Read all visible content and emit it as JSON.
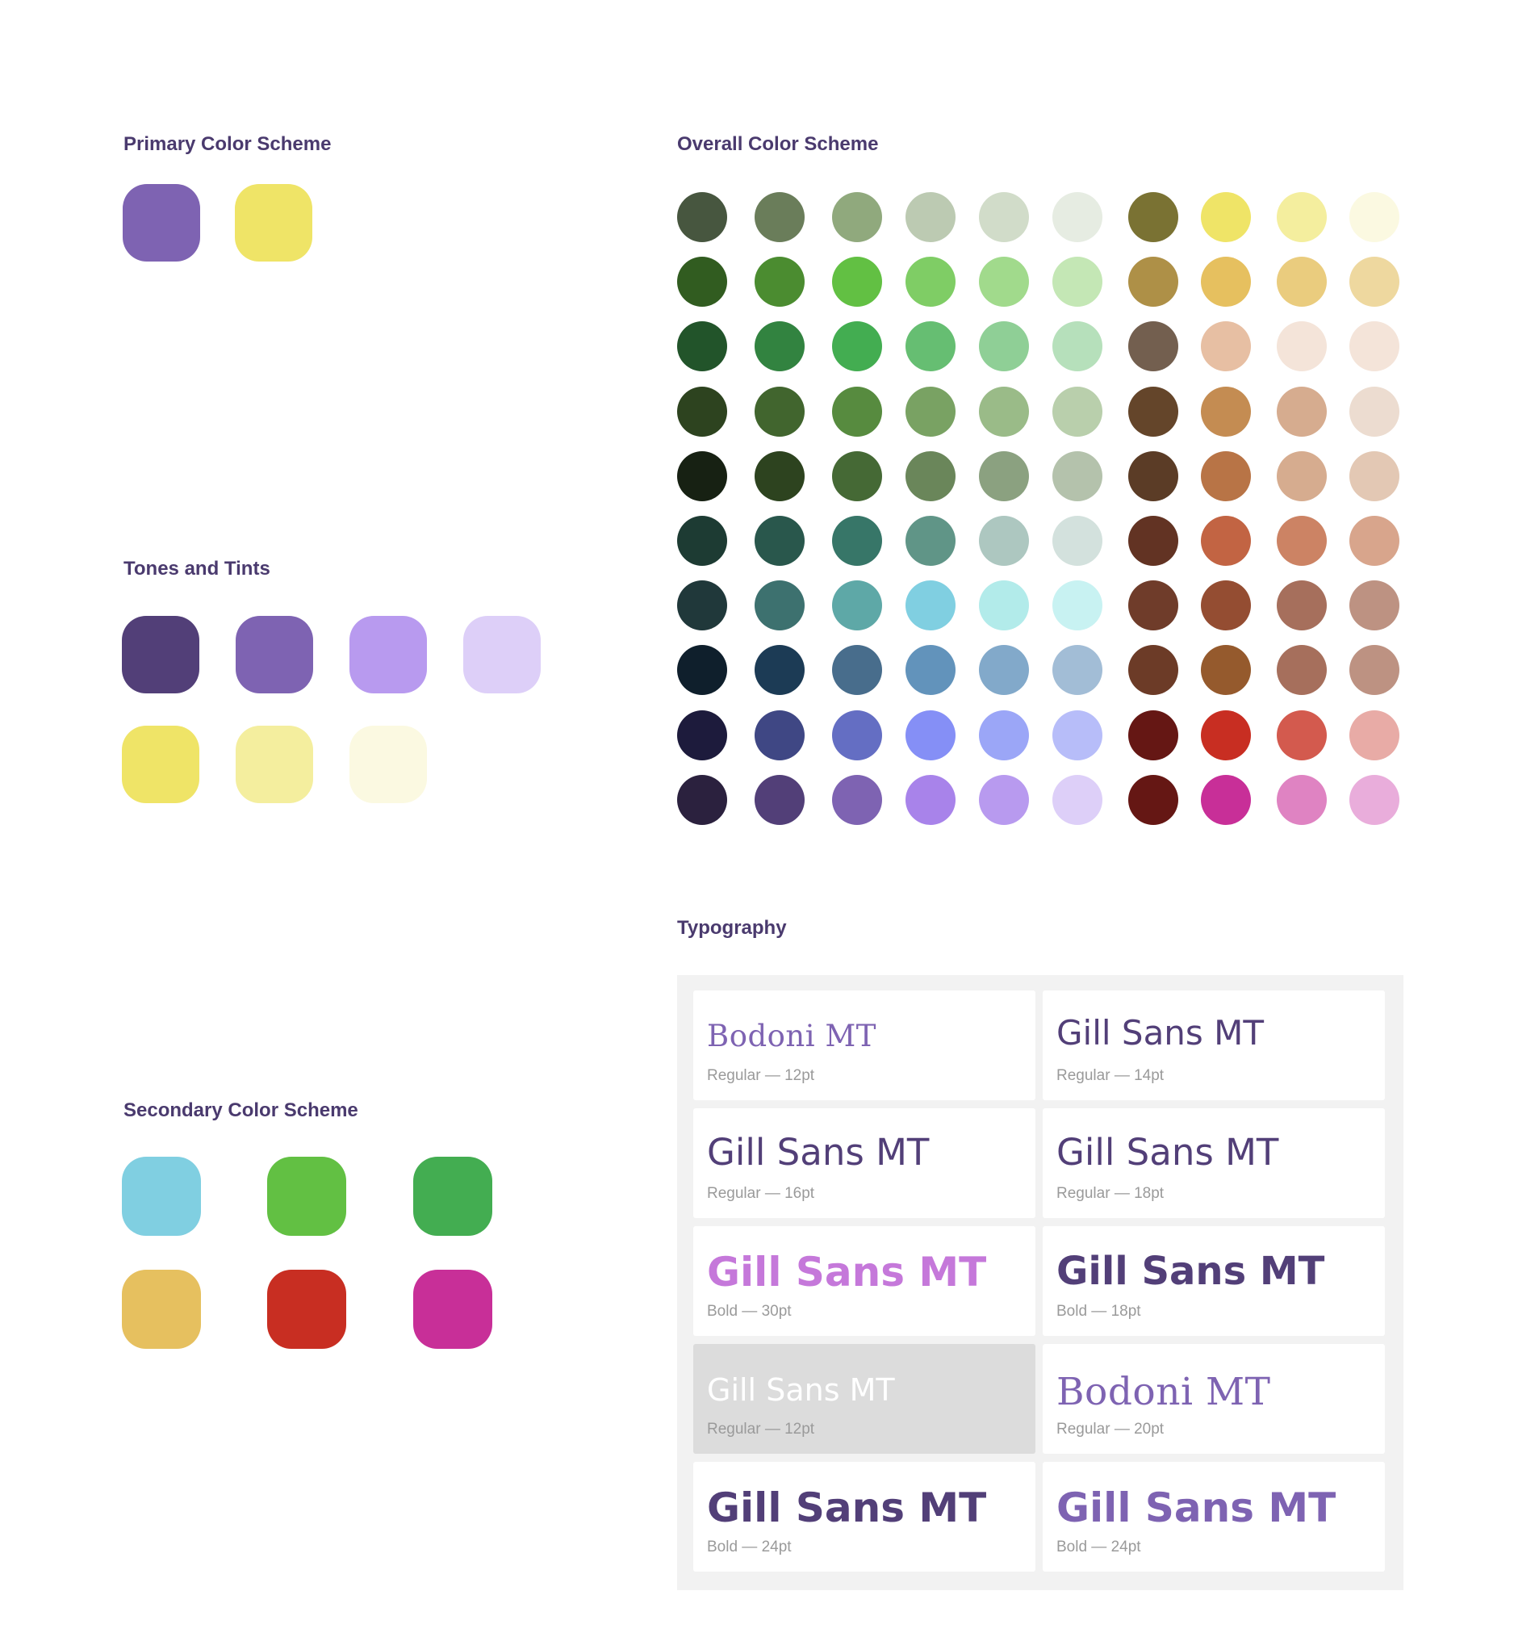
{
  "primary": {
    "title": "Primary Color Scheme",
    "swatches": [
      "#7e63b2",
      "#efe467"
    ]
  },
  "tones": {
    "title": "Tones and Tints",
    "row1": [
      "#523f78",
      "#7e63b2",
      "#b89aef",
      "#ddcff8"
    ],
    "row2": [
      "#efe467",
      "#f4ee9e",
      "#fbf9e1"
    ]
  },
  "secondary": {
    "title": "Secondary Color Scheme",
    "swatches": [
      "#80cfe1",
      "#62c043",
      "#43ad51",
      "#e6c05f",
      "#c82e22",
      "#c82f98"
    ]
  },
  "overall": {
    "title": "Overall Color Scheme",
    "rows": [
      [
        "#47563f",
        "#6a7d5a",
        "#90a97d",
        "#bccab2",
        "#d1dcc9",
        "#e6ece2",
        "#7a7233",
        "#efe467",
        "#f4ee9e",
        "#fbf9e1"
      ],
      [
        "#315c20",
        "#4b8c30",
        "#62c043",
        "#7fcd65",
        "#a1da8c",
        "#c4e7b5",
        "#ae9047",
        "#e6c05f",
        "#eacc7e",
        "#eed89f"
      ],
      [
        "#22542a",
        "#328340",
        "#43ad51",
        "#66be72",
        "#8fcf96",
        "#b6e0bb",
        "#735f4f",
        "#e7bfa3",
        "#f4e4d9",
        "#f4e4d9"
      ],
      [
        "#2d431f",
        "#41652e",
        "#578b3f",
        "#79a263",
        "#9abb88",
        "#b9cfac",
        "#64452a",
        "#c48c52",
        "#d6ac8f",
        "#ecdcd0"
      ],
      [
        "#172113",
        "#2d431f",
        "#456935",
        "#6a865a",
        "#8ba180",
        "#b4c2ac",
        "#5b3c26",
        "#b87446",
        "#d6ac8f",
        "#e3c8b4"
      ],
      [
        "#1d3b33",
        "#29574c",
        "#377668",
        "#609587",
        "#adc7c0",
        "#d3e1dd",
        "#623323",
        "#c26443",
        "#cc8364",
        "#d8a58c"
      ],
      [
        "#20383a",
        "#3d716f",
        "#5ea8a7",
        "#80cfe1",
        "#b2ebea",
        "#c8f2f2",
        "#6f3c2a",
        "#944d32",
        "#a66f5c",
        "#bd9282"
      ],
      [
        "#0f1f2c",
        "#1c3b55",
        "#486d8c",
        "#6293bb",
        "#82a9ca",
        "#a2bdd6",
        "#6c3b27",
        "#955a2d",
        "#a66f5c",
        "#bd9282"
      ],
      [
        "#1d1b3c",
        "#3f4784",
        "#646ec3",
        "#858ff6",
        "#9ba6f7",
        "#b7bdf9",
        "#651714",
        "#c82e22",
        "#d35a4e",
        "#e8aba6"
      ],
      [
        "#2b213e",
        "#523f78",
        "#7e63b2",
        "#a883ea",
        "#b89aef",
        "#ddcff8",
        "#651714",
        "#c82f98",
        "#df83c2",
        "#e9addb"
      ]
    ]
  },
  "typography": {
    "title": "Typography",
    "cards": [
      {
        "text": "Bodoni MT",
        "caption": "Regular — 12pt",
        "color": "#7e63b2",
        "family": "serif",
        "weight": "normal"
      },
      {
        "text": "Gill Sans MT",
        "caption": "Regular — 14pt",
        "color": "#523f78",
        "family": "sans",
        "weight": "normal"
      },
      {
        "text": "Gill Sans MT",
        "caption": "Regular — 16pt",
        "color": "#523f78",
        "family": "sans",
        "weight": "normal"
      },
      {
        "text": "Gill Sans MT",
        "caption": "Regular — 18pt",
        "color": "#523f78",
        "family": "sans",
        "weight": "normal"
      },
      {
        "text": "Gill Sans MT",
        "caption": "Bold — 30pt",
        "color": "#c578da",
        "family": "sans",
        "weight": "bold"
      },
      {
        "text": "Gill Sans MT",
        "caption": "Bold — 18pt",
        "color": "#523f78",
        "family": "sans",
        "weight": "bold"
      },
      {
        "text": "Gill Sans MT",
        "caption": "Regular — 12pt",
        "color": "#ffffff",
        "family": "sans",
        "weight": "normal",
        "muted": true
      },
      {
        "text": "Bodoni MT",
        "caption": "Regular — 20pt",
        "color": "#7e63b2",
        "family": "serif",
        "weight": "normal"
      },
      {
        "text": "Gill Sans MT",
        "caption": "Bold — 24pt",
        "color": "#523f78",
        "family": "sans",
        "weight": "bold"
      },
      {
        "text": "Gill Sans MT",
        "caption": "Bold — 24pt",
        "color": "#7e63b2",
        "family": "sans",
        "weight": "bold"
      }
    ]
  }
}
